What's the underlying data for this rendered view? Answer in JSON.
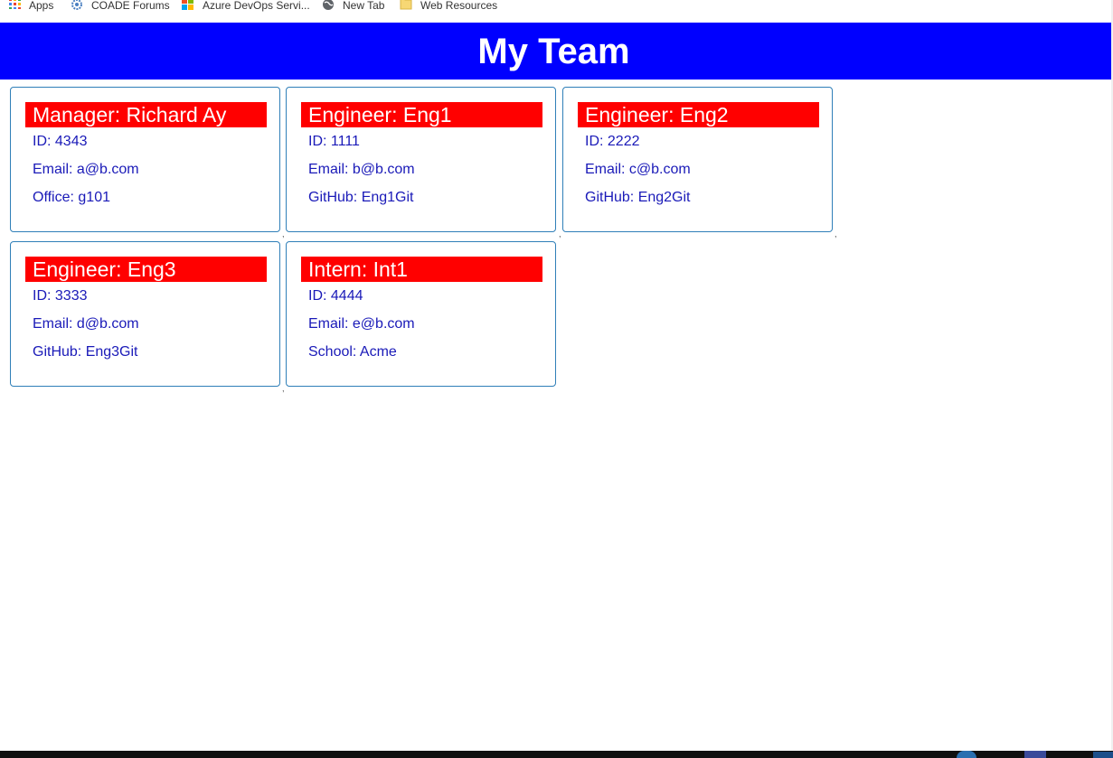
{
  "bookmarks": {
    "items": [
      {
        "label": "Apps",
        "icon": "apps-grid-icon"
      },
      {
        "label": "COADE Forums",
        "icon": "gear-icon"
      },
      {
        "label": "Azure DevOps Servi...",
        "icon": "windows-logo-icon"
      },
      {
        "label": "New Tab",
        "icon": "globe-icon"
      },
      {
        "label": "Web Resources",
        "icon": "folder-icon"
      }
    ]
  },
  "header": {
    "title": "My Team"
  },
  "cards": [
    {
      "title": "Manager: Richard Ay",
      "id": "ID: 4343",
      "email": "Email: a@b.com",
      "extra": "Office: g101"
    },
    {
      "title": "Engineer: Eng1",
      "id": "ID: 1111",
      "email": "Email: b@b.com",
      "extra": "GitHub: Eng1Git"
    },
    {
      "title": "Engineer: Eng2",
      "id": "ID: 2222",
      "email": "Email: c@b.com",
      "extra": "GitHub: Eng2Git"
    },
    {
      "title": "Engineer: Eng3",
      "id": "ID: 3333",
      "email": "Email: d@b.com",
      "extra": "GitHub: Eng3Git"
    },
    {
      "title": "Intern: Int1",
      "id": "ID: 4444",
      "email": "Email: e@b.com",
      "extra": "School: Acme"
    }
  ],
  "separator": ",",
  "colors": {
    "header_bg": "#0000ff",
    "card_title_bg": "#ff0000",
    "card_text": "#1a1ab8",
    "card_border": "#2f7fb8"
  }
}
